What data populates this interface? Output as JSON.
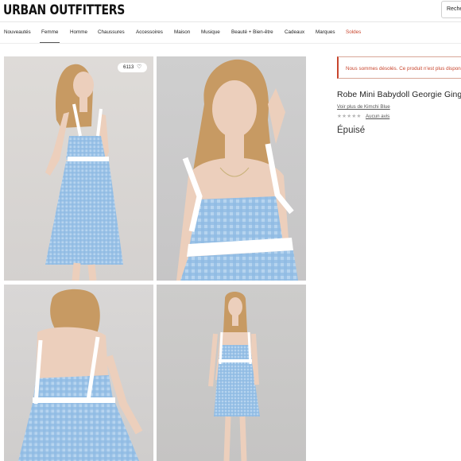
{
  "header": {
    "logo": "URBAN OUTFITTERS",
    "search_text": "Reche"
  },
  "nav": {
    "items": [
      {
        "label": "Nouveautés",
        "active": false
      },
      {
        "label": "Femme",
        "active": true
      },
      {
        "label": "Homme",
        "active": false
      },
      {
        "label": "Chaussures",
        "active": false
      },
      {
        "label": "Accessoires",
        "active": false
      },
      {
        "label": "Maison",
        "active": false
      },
      {
        "label": "Musique",
        "active": false
      },
      {
        "label": "Beauté + Bien-être",
        "active": false
      },
      {
        "label": "Cadeaux",
        "active": false
      },
      {
        "label": "Marques",
        "active": false
      },
      {
        "label": "Soldes",
        "active": false
      }
    ],
    "sale_color": "#c8452d"
  },
  "gallery": {
    "favorites_count": "6113",
    "favorite_icon": "heart-outline-icon",
    "dress_color": "#9cc3e6",
    "ribbon_color": "#ffffff"
  },
  "product": {
    "alert": "Nous sommes désolés. Ce produit n'est plus disponible",
    "title": "Robe Mini Babydoll Georgie Gingham",
    "brand_link": "Voir plus de Kimchi Blue",
    "stars": "★★★★★",
    "reviews_link": "Aucun avis",
    "status": "Épuisé"
  }
}
